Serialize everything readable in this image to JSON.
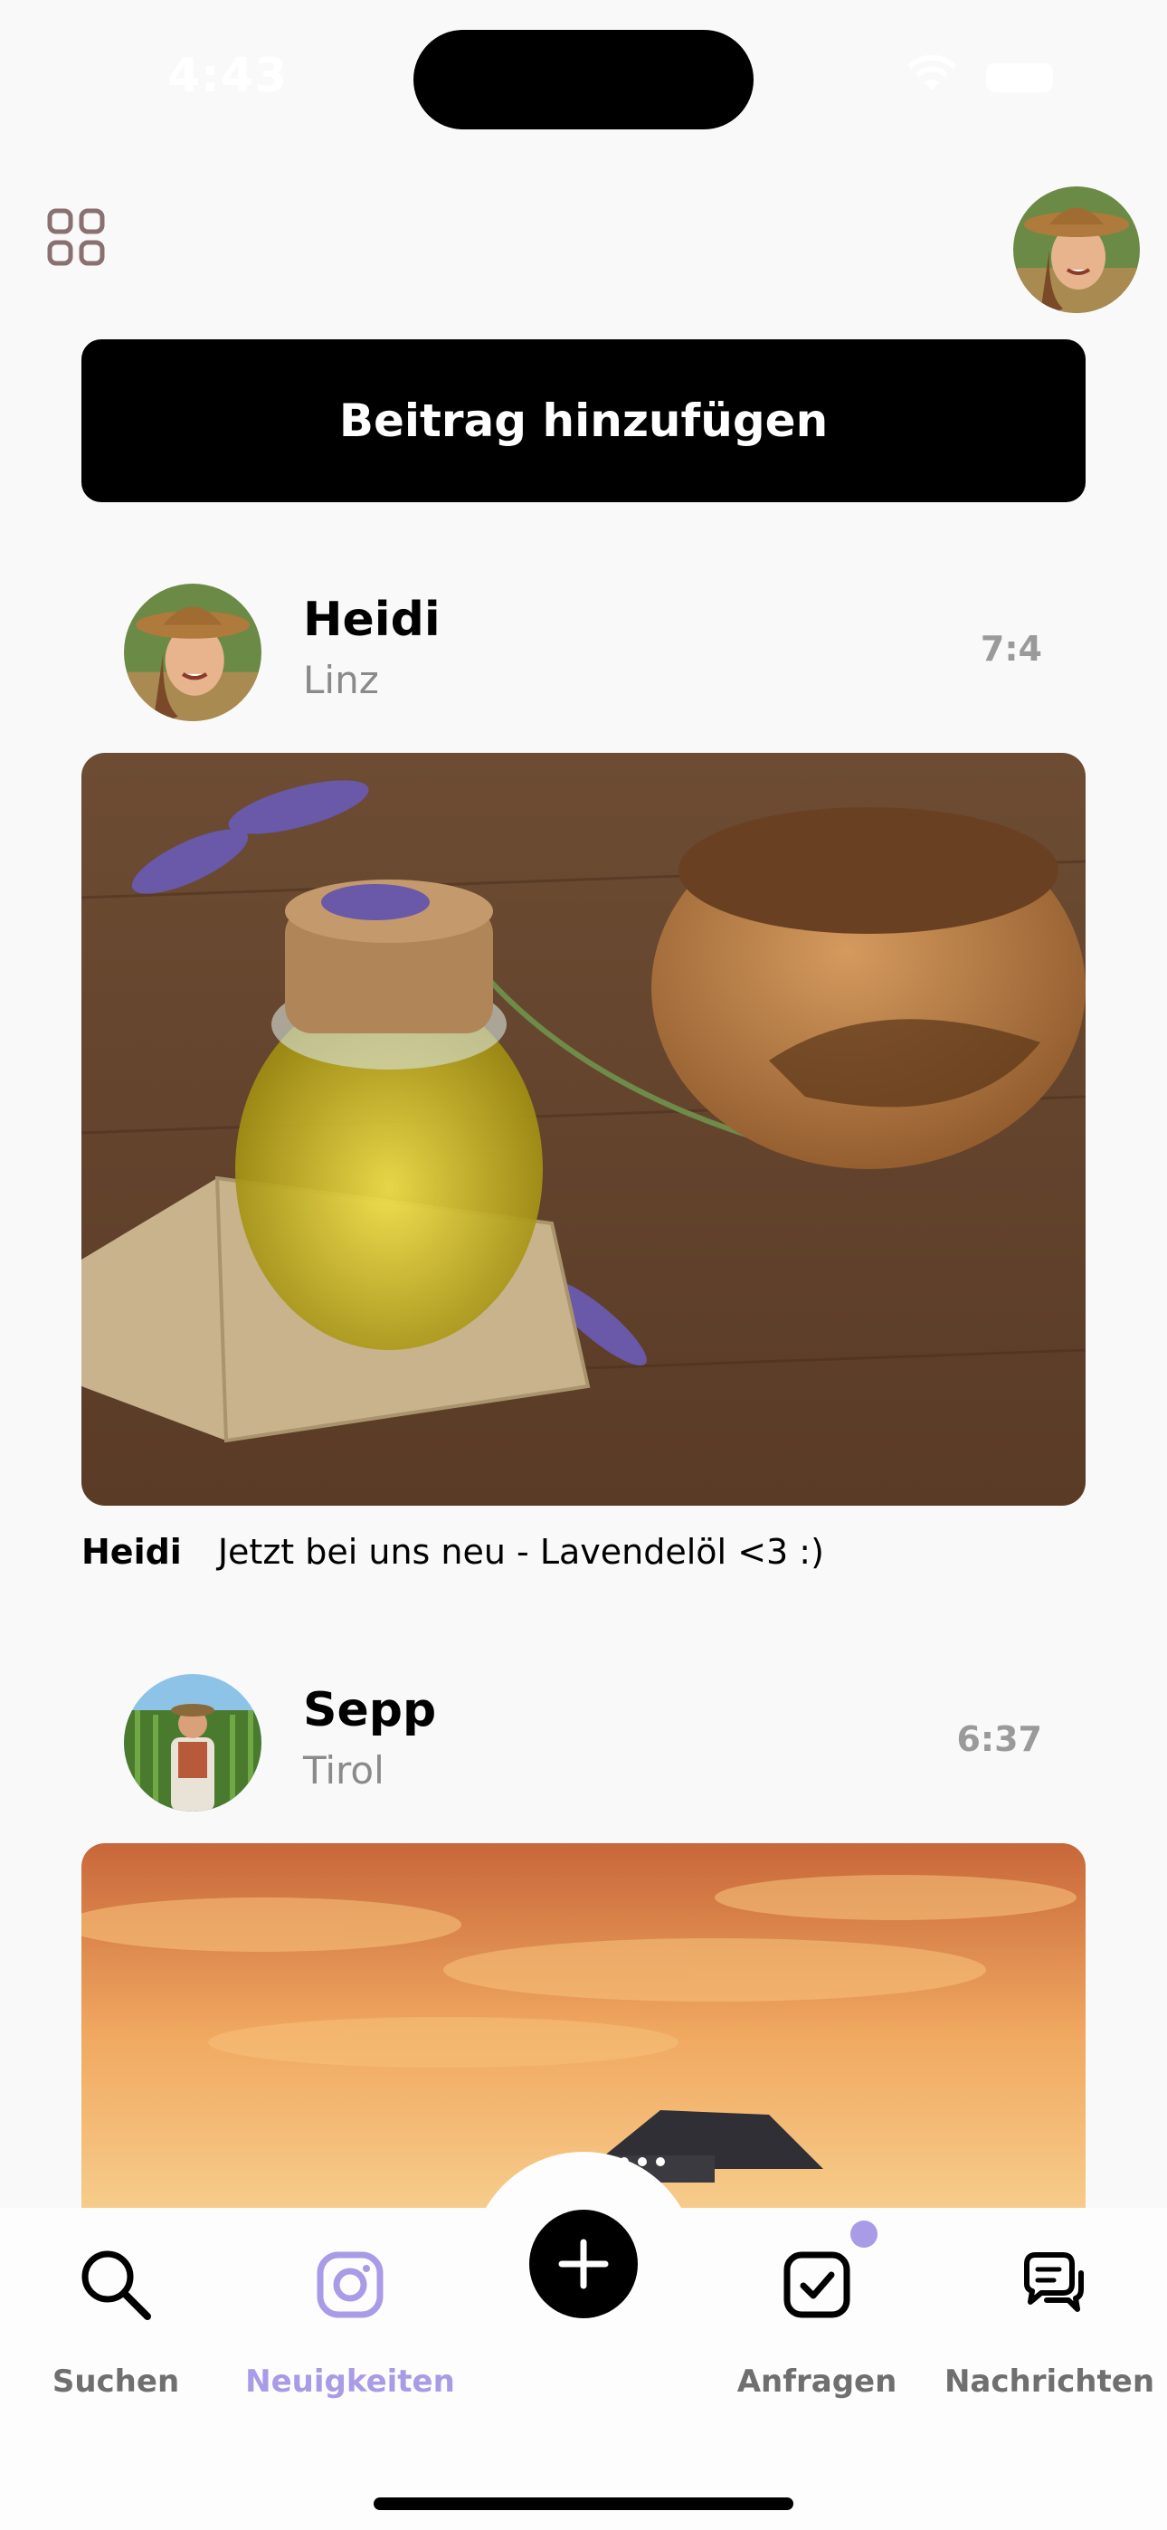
{
  "status_bar": {
    "time": "4:43"
  },
  "header": {
    "menu_icon": "grid-icon",
    "profile_avatar": "user-avatar"
  },
  "add_post": {
    "label": "Beitrag hinzufügen"
  },
  "posts": [
    {
      "name": "Heidi",
      "location": "Linz",
      "time": "7:4",
      "caption_author": "Heidi",
      "caption_text": "Jetzt bei uns neu - Lavendelöl <3 :)"
    },
    {
      "name": "Sepp",
      "location": "Tirol",
      "time": "6:37"
    }
  ],
  "nav": {
    "items": [
      {
        "label": "Suchen",
        "icon": "search-icon"
      },
      {
        "label": "Neuigkeiten",
        "icon": "instagram-icon",
        "active": true
      },
      {
        "label": "",
        "icon": "plus-icon"
      },
      {
        "label": "Anfragen",
        "icon": "checkbox-icon"
      },
      {
        "label": "Nachrichten",
        "icon": "chat-icon"
      }
    ],
    "accent_color": "#a99be6"
  }
}
